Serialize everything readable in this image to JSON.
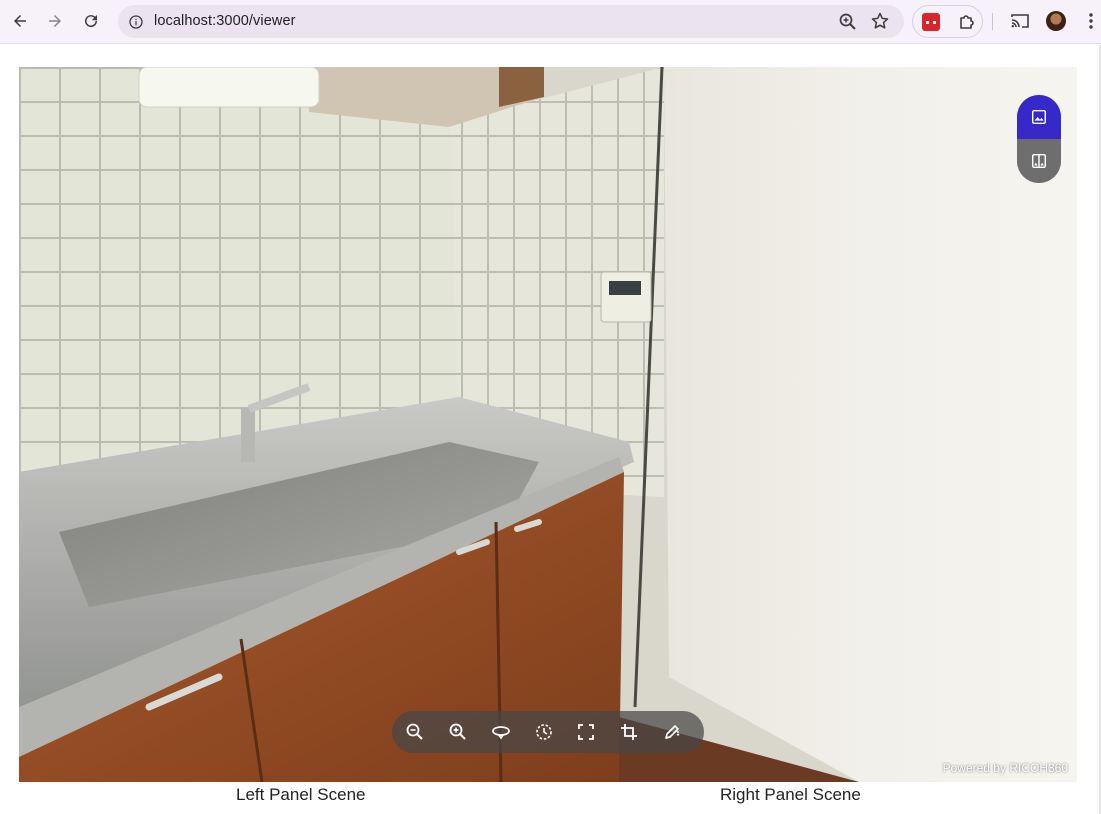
{
  "browser": {
    "url": "localhost:3000/viewer",
    "icons": [
      "back-arrow-icon",
      "forward-arrow-icon",
      "reload-icon",
      "site-info-icon",
      "zoom-icon",
      "bookmark-star-icon",
      "extension-icon",
      "puzzle-icon",
      "cast-icon",
      "profile-avatar",
      "kebab-menu-icon"
    ]
  },
  "viewer": {
    "powered_by": "Powered by RICOH360",
    "mode_toggle": {
      "single_icon": "image-icon",
      "split_icon": "split-view-icon",
      "active": "single",
      "active_color": "#3728c9"
    },
    "toolbar": {
      "tools": [
        "zoom-out-icon",
        "zoom-in-icon",
        "rotate-icon",
        "auto-rotate-icon",
        "fullscreen-icon",
        "crop-icon",
        "edit-icon"
      ]
    }
  },
  "captions": {
    "left": "Left Panel Scene",
    "right": "Right Panel Scene"
  }
}
